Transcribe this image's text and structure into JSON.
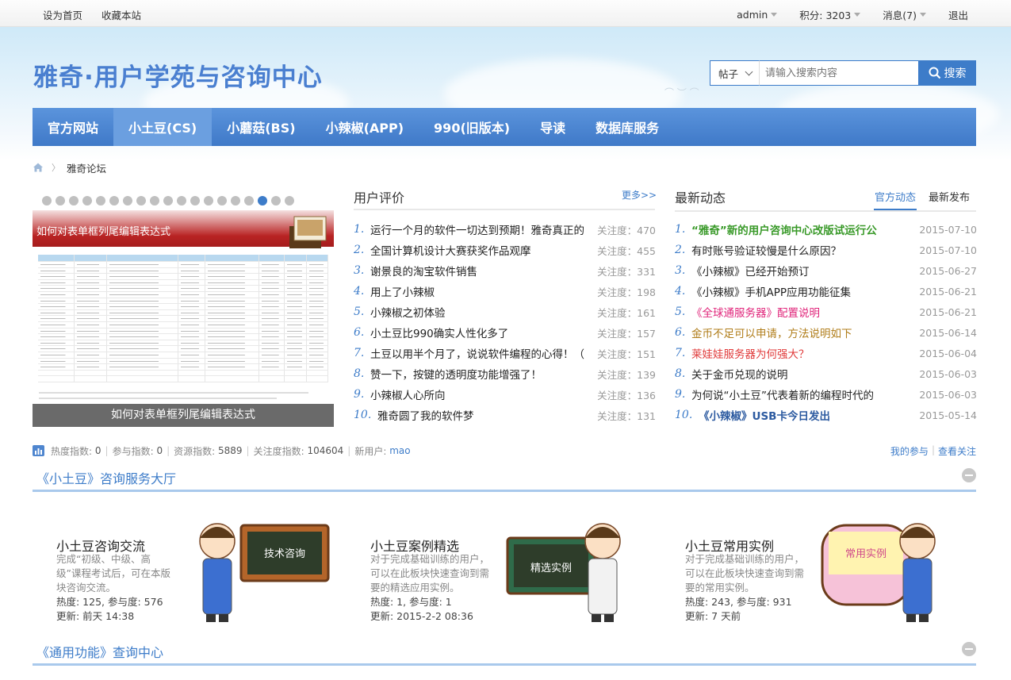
{
  "topbar": {
    "left": [
      "设为首页",
      "收藏本站"
    ],
    "user": "admin",
    "points": "积分: 3203",
    "messages": "消息(7)",
    "logout": "退出"
  },
  "header": {
    "title": "雅奇·用户学苑与咨询中心",
    "search_type": "帖子",
    "search_placeholder": "请输入搜索内容",
    "search_button": "搜索"
  },
  "nav": [
    "官方网站",
    "小土豆(CS)",
    "小蘑菇(BS)",
    "小辣椒(APP)",
    "990(旧版本)",
    "导读",
    "数据库服务"
  ],
  "breadcrumb": {
    "current": "雅奇论坛"
  },
  "slider": {
    "banner_text": "如何对表单框列尾编辑表达式",
    "caption": "如何对表单框列尾编辑表达式",
    "dot_count": 19,
    "active_dot": 16
  },
  "reviews": {
    "title": "用户评价",
    "more": "更多>>",
    "items": [
      {
        "n": "1.",
        "text": "运行一个月的软件一切达到预期！雅奇真正的",
        "meta": "关注度：470"
      },
      {
        "n": "2.",
        "text": "全国计算机设计大赛获奖作品观摩",
        "meta": "关注度：455"
      },
      {
        "n": "3.",
        "text": "谢景良的淘宝软件销售",
        "meta": "关注度：331"
      },
      {
        "n": "4.",
        "text": "用上了小辣椒",
        "meta": "关注度：198"
      },
      {
        "n": "5.",
        "text": "小辣椒之初体验",
        "meta": "关注度：161"
      },
      {
        "n": "6.",
        "text": "小土豆比990确实人性化多了",
        "meta": "关注度：157"
      },
      {
        "n": "7.",
        "text": "土豆以用半个月了，说说软件编程的心得！（",
        "meta": "关注度：151"
      },
      {
        "n": "8.",
        "text": "赞一下，按键的透明度功能增强了！",
        "meta": "关注度：139"
      },
      {
        "n": "9.",
        "text": "小辣椒人心所向",
        "meta": "关注度：136"
      },
      {
        "n": "10.",
        "text": "雅奇圆了我的软件梦",
        "meta": "关注度：131"
      }
    ]
  },
  "news": {
    "title": "最新动态",
    "tabs": [
      "官方动态",
      "最新发布"
    ],
    "items": [
      {
        "n": "1.",
        "text": "“雅奇”新的用户咨询中心改版试运行公",
        "date": "2015-07-10",
        "color": "#3a9a2a",
        "bold": true
      },
      {
        "n": "2.",
        "text": "有时账号验证较慢是什么原因？",
        "date": "2015-07-10",
        "color": "#222",
        "bold": false
      },
      {
        "n": "3.",
        "text": "《小辣椒》已经开始预订",
        "date": "2015-06-27",
        "color": "#222",
        "bold": false
      },
      {
        "n": "4.",
        "text": "《小辣椒》手机APP应用功能征集",
        "date": "2015-06-21",
        "color": "#222",
        "bold": false
      },
      {
        "n": "5.",
        "text": "《全球通服务器》配置说明",
        "date": "2015-06-21",
        "color": "#e0247a",
        "bold": false
      },
      {
        "n": "6.",
        "text": "金币不足可以申请，方法说明如下",
        "date": "2015-06-14",
        "color": "#b07d1a",
        "bold": false
      },
      {
        "n": "7.",
        "text": "莱娃娃服务器为何强大？",
        "date": "2015-06-04",
        "color": "#e03a3a",
        "bold": false
      },
      {
        "n": "8.",
        "text": "关于金币兑现的说明",
        "date": "2015-06-03",
        "color": "#222",
        "bold": false
      },
      {
        "n": "9.",
        "text": "为何说“小土豆”代表着新的编程时代的",
        "date": "2015-06-03",
        "color": "#222",
        "bold": false
      },
      {
        "n": "10.",
        "text": "《小辣椒》USB卡今日发出",
        "date": "2015-05-14",
        "color": "#2c5aa0",
        "bold": true
      }
    ]
  },
  "stats": {
    "hot_label": "热度指数:",
    "hot": "0",
    "part_label": "参与指数:",
    "part": "0",
    "res_label": "资源指数:",
    "res": "5889",
    "focus_label": "关注度指数:",
    "focus": "104604",
    "newuser_label": "新用户:",
    "newuser": "mao",
    "my": "我的参与",
    "follow": "查看关注"
  },
  "sections": [
    "《小土豆》咨询服务大厅",
    "《通用功能》查询中心"
  ],
  "forums": [
    {
      "name": "小土豆咨询交流",
      "desc": "完成“初级、中级、高级”课程考试后，可在本版块咨询交流。",
      "stat": "热度: 125, 参与度: 576",
      "update": "更新: 前天 14:38",
      "board": "技术咨询"
    },
    {
      "name": "小土豆案例精选",
      "desc": "对于完成基础训练的用户，可以在此板块快速查询到需要的精选应用实例。",
      "stat": "热度: 1, 参与度: 1",
      "update": "更新: 2015-2-2 08:36",
      "board": "精选实例"
    },
    {
      "name": "小土豆常用实例",
      "desc": "对于完成基础训练的用户，可以在此板块快速查询到需要的常用实例。",
      "stat": "热度: 243, 参与度: 931",
      "update": "更新: 7 天前",
      "board": "常用实例"
    }
  ]
}
